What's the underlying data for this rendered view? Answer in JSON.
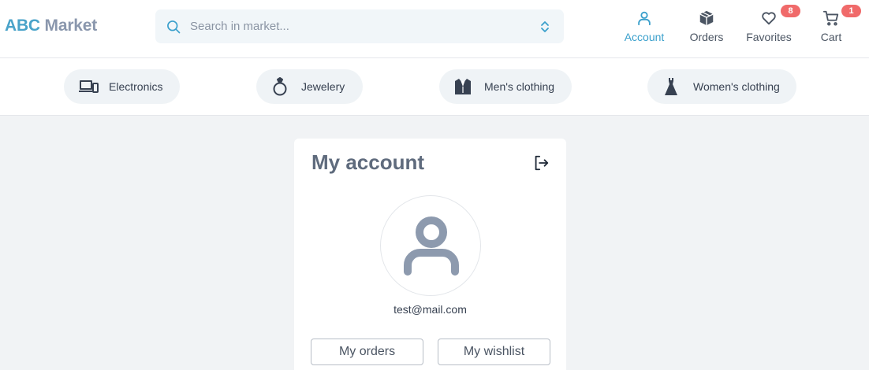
{
  "header": {
    "logo_part1": "ABC",
    "logo_part2": "Market",
    "search_placeholder": "Search in market...",
    "nav": {
      "account": "Account",
      "orders": "Orders",
      "favorites": "Favorites",
      "cart": "Cart"
    },
    "favorites_count": "8",
    "cart_count": "1"
  },
  "categories": {
    "electronics": "Electronics",
    "jewelery": "Jewelery",
    "mens": "Men's clothing",
    "womens": "Women's clothing"
  },
  "account": {
    "title": "My account",
    "email": "test@mail.com",
    "orders_button": "My orders",
    "wishlist_button": "My wishlist"
  },
  "colors": {
    "accent": "#3ba0cc",
    "logo_primary": "#4aa3c9",
    "logo_secondary": "#8a97ad",
    "badge": "#f06a6a",
    "background": "#f1f3f5"
  },
  "icons": [
    "search-icon",
    "sort-icon",
    "user-icon",
    "box-icon",
    "heart-icon",
    "cart-icon",
    "devices-icon",
    "ring-icon",
    "shirt-icon",
    "dress-icon",
    "logout-icon",
    "avatar-icon"
  ]
}
